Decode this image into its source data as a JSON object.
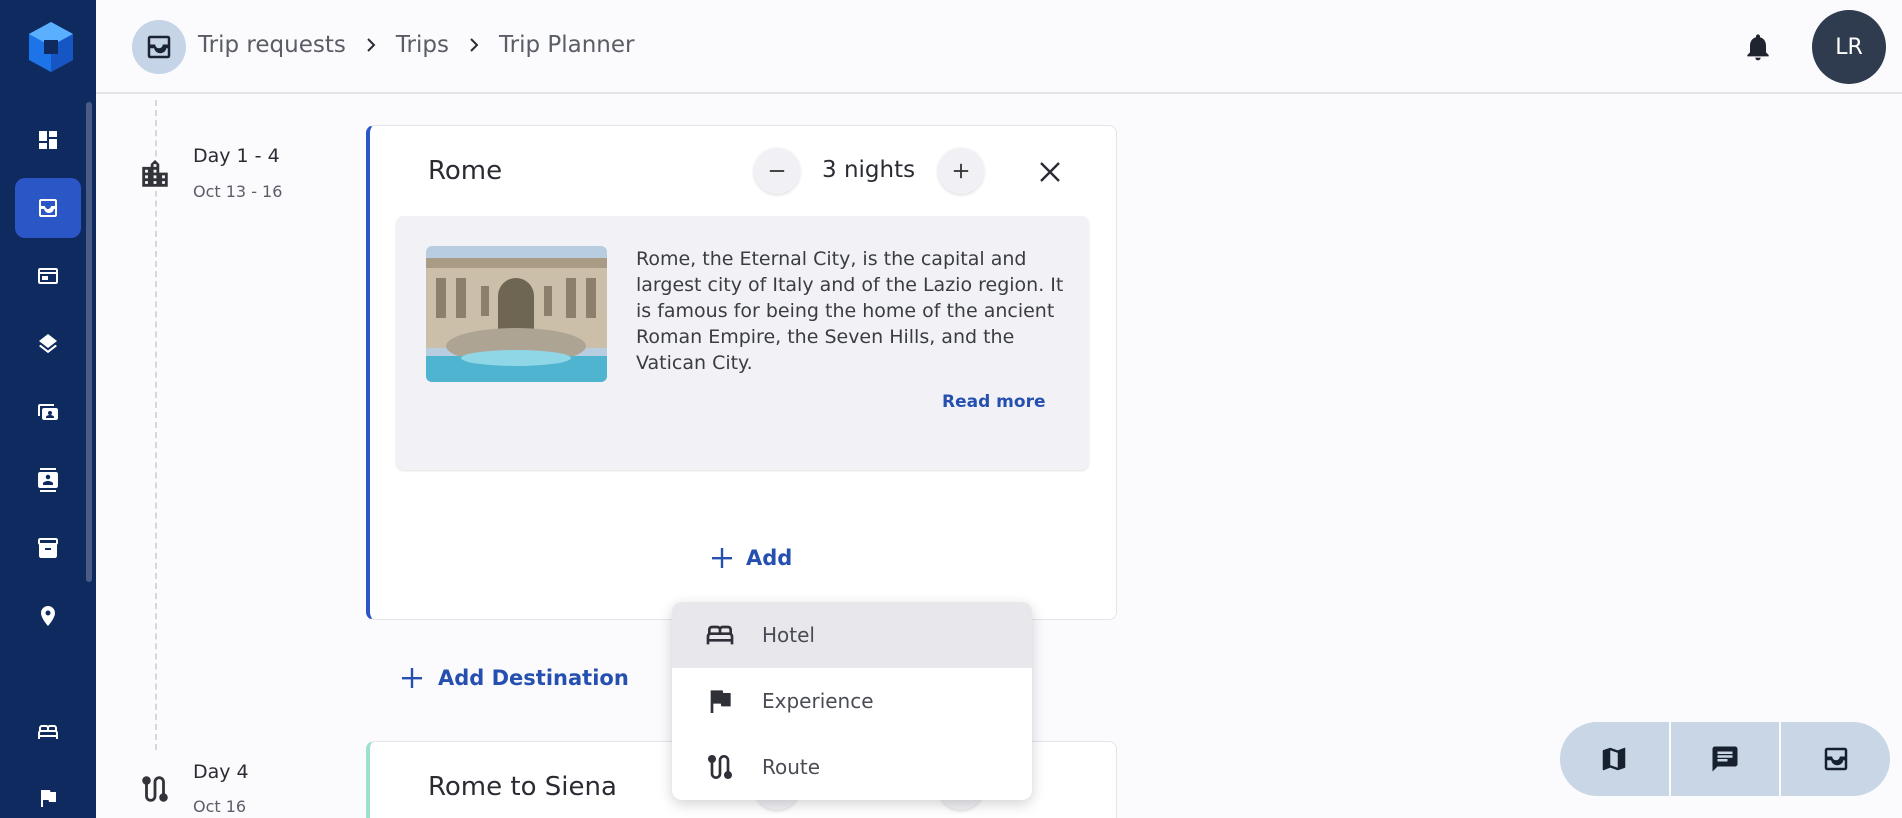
{
  "header": {
    "breadcrumbs": [
      "Trip requests",
      "Trips",
      "Trip Planner"
    ],
    "avatar_initials": "LR"
  },
  "timeline": {
    "days": [
      {
        "label": "Day 1 - 4",
        "date": "Oct 13 - 16",
        "icon": "city-icon"
      },
      {
        "label": "Day 4",
        "date": "Oct 16",
        "icon": "route-icon"
      }
    ]
  },
  "destination": {
    "city": "Rome",
    "nights_label": "3 nights",
    "description": "Rome, the Eternal City, is the capital and largest city of Italy and of the Lazio region. It is famous for being the home of the ancient Roman Empire, the Seven Hills, and the Vatican City.",
    "read_more": "Read more",
    "add_label": "Add"
  },
  "add_destination_label": "Add Destination",
  "next_card": {
    "title": "Rome to Siena"
  },
  "add_menu": {
    "items": [
      {
        "label": "Hotel",
        "icon": "bed-icon"
      },
      {
        "label": "Experience",
        "icon": "flag-icon"
      },
      {
        "label": "Route",
        "icon": "route-icon"
      }
    ]
  },
  "colors": {
    "sidebar": "#0f2a5e",
    "accent": "#2650b0",
    "active_item": "#2a56c6"
  }
}
